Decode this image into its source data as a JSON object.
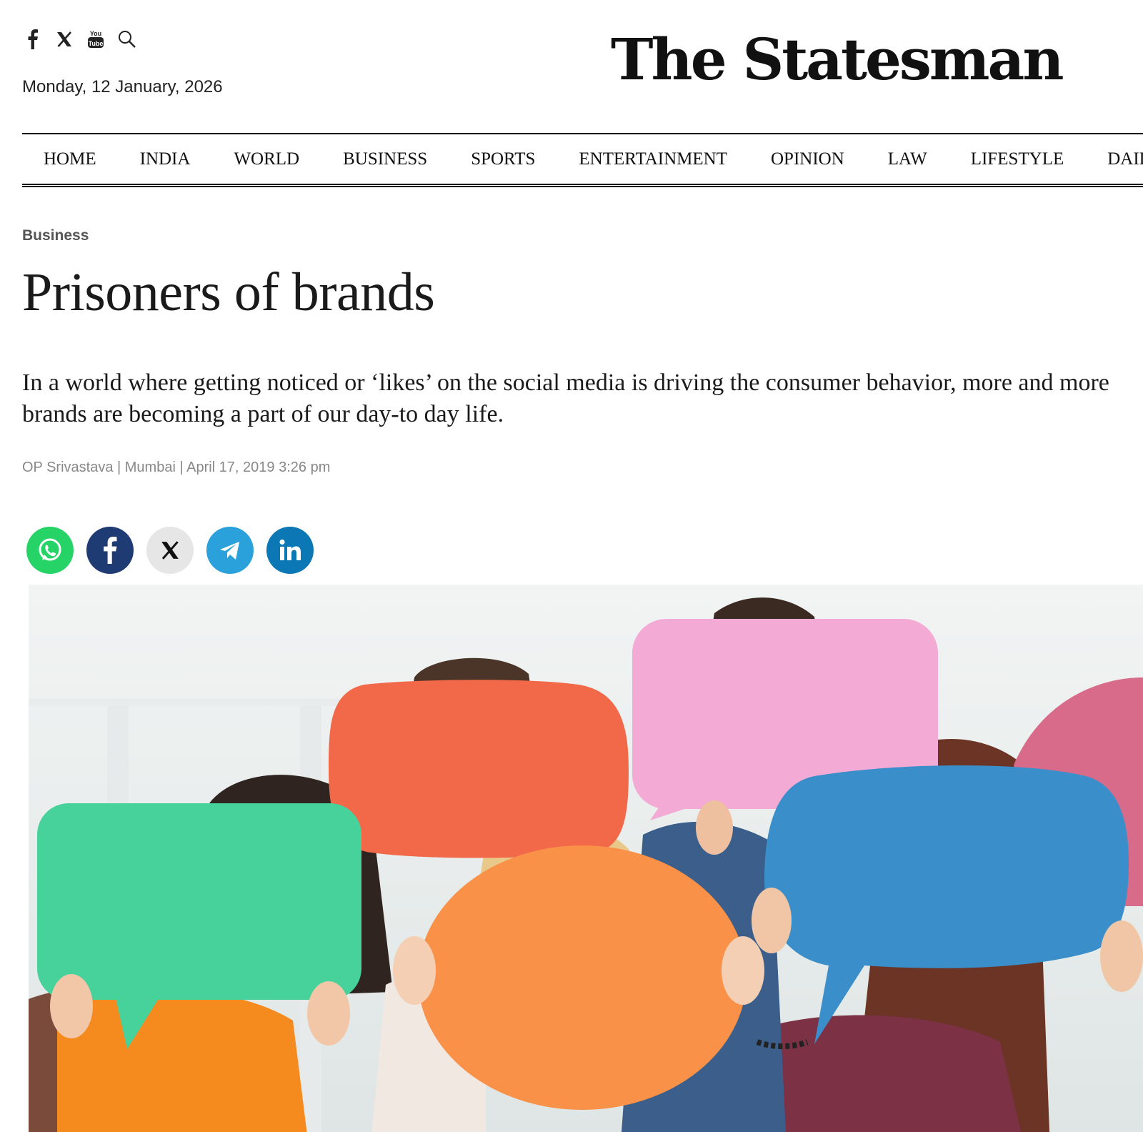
{
  "header": {
    "date": "Monday, 12 January, 2026",
    "logo_text": "The Statesman",
    "social_icons": [
      "facebook-icon",
      "x-icon",
      "youtube-icon",
      "search-icon"
    ],
    "youtube_text_top": "You",
    "youtube_text_bottom": "Tube"
  },
  "nav": {
    "items": [
      "HOME",
      "INDIA",
      "WORLD",
      "BUSINESS",
      "SPORTS",
      "ENTERTAINMENT",
      "OPINION",
      "LAW",
      "LIFESTYLE",
      "DAILY"
    ]
  },
  "article": {
    "category": "Business",
    "title": "Prisoners of brands",
    "summary": "In a world where getting noticed or ‘likes’ on the social media is driving the consumer behavior, more and more brands are becoming a part of our day-to day life.",
    "byline": "OP Srivastava | Mumbai | April 17, 2019 3:26 pm"
  },
  "share": {
    "buttons": [
      "whatsapp-icon",
      "facebook-icon",
      "x-icon",
      "telegram-icon",
      "linkedin-icon"
    ],
    "colors": {
      "whatsapp": "#25d366",
      "facebook": "#1f3b73",
      "x": "#e6e6e6",
      "telegram": "#2aa1da",
      "linkedin": "#0b77b5"
    }
  },
  "image": {
    "subject": "people-holding-speech-bubbles",
    "bubble_colors": [
      "#47d19b",
      "#f2694a",
      "#f3aad4",
      "#f99148",
      "#3a8ec9",
      "#d96b8a"
    ]
  }
}
